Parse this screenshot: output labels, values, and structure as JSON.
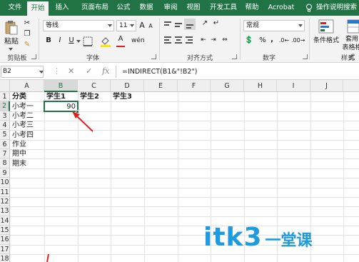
{
  "ribbon_tabs": [
    "文件",
    "开始",
    "插入",
    "页面布局",
    "公式",
    "数据",
    "审阅",
    "视图",
    "开发工具",
    "帮助",
    "Acrobat",
    "操作说明搜索"
  ],
  "active_tab": "开始",
  "clipboard": {
    "paste_label": "粘贴",
    "group_label": "剪贴板"
  },
  "font": {
    "font_name": "等线",
    "font_size": "11",
    "bold": "B",
    "italic": "I",
    "underline": "U",
    "grow_font": "A",
    "shrink_font": "A",
    "change_case": "wén",
    "group_label": "字体"
  },
  "alignment": {
    "group_label": "对齐方式"
  },
  "number": {
    "format": "常规",
    "currency": "%",
    "comma": ",",
    "percent_label": "%",
    "group_label": "数字"
  },
  "styles": {
    "conditional_format": "条件格式",
    "table_format_1": "套用",
    "table_format_2": "表格格式",
    "group_label": "样式"
  },
  "formula_bar": {
    "name_box": "B2",
    "cancel": "✕",
    "enter": "✓",
    "fx": "fx",
    "formula": "=INDIRECT(B1&\"!B2\")"
  },
  "columns": [
    "A",
    "B",
    "C",
    "D",
    "E",
    "F",
    "G",
    "H",
    "I",
    "J"
  ],
  "selected_column": "B",
  "rows": [
    "1",
    "2",
    "3",
    "4",
    "5",
    "6",
    "7",
    "8",
    "9",
    "10",
    "11",
    "12",
    "13",
    "14",
    "15",
    "16",
    "17",
    "18"
  ],
  "selected_row": "2",
  "cells": {
    "A1": "分类",
    "B1": "学生1",
    "C1": "学生2",
    "D1": "学生3",
    "A2": "小考一",
    "B2": "90",
    "A3": "小考二",
    "A4": "小考三",
    "A5": "小考四",
    "A6": "作业",
    "A7": "期中",
    "A8": "期末"
  },
  "watermark": {
    "latin": "itk3",
    "cn": "一堂课"
  },
  "colors": {
    "excel_green": "#217346",
    "arrow_red": "#e02020",
    "watermark_blue": "#1e9be0"
  }
}
